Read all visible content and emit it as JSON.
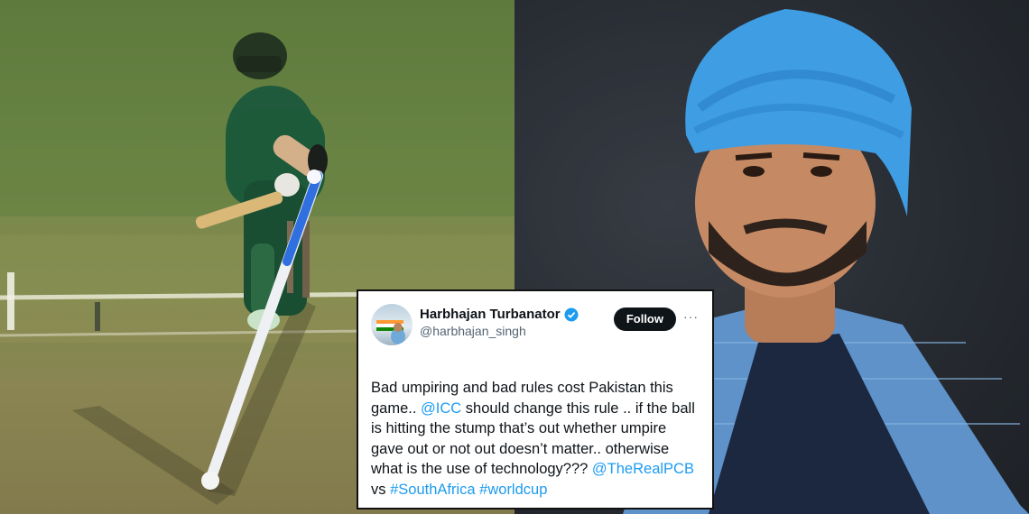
{
  "left_photo": {
    "icon": "cricket-stumping-photo"
  },
  "right_photo": {
    "icon": "portrait-photo"
  },
  "tweet": {
    "display_name": "Harbhajan Turbanator",
    "handle": "@harbhajan_singh",
    "follow_label": "Follow",
    "more_label": "···",
    "verified_icon": "verified-badge-icon",
    "verified_color": "#1d9bf0",
    "segments": [
      {
        "text": "Bad umpiring and bad rules cost Pakistan this game.. ",
        "link": false
      },
      {
        "text": "@ICC",
        "link": true
      },
      {
        "text": " should change this rule .. if the ball is hitting the stump that’s out whether umpire gave out or not out doesn’t matter.. otherwise what is the use of technology??? ",
        "link": false
      },
      {
        "text": "@TheRealPCB",
        "link": true
      },
      {
        "text": " vs ",
        "link": false
      },
      {
        "text": "#SouthAfrica",
        "link": true
      },
      {
        "text": " ",
        "link": false
      },
      {
        "text": "#worldcup",
        "link": true
      }
    ]
  },
  "colors": {
    "link": "#1d9bf0",
    "turban": "#3f9de3",
    "jacket": "#5e92c9"
  }
}
